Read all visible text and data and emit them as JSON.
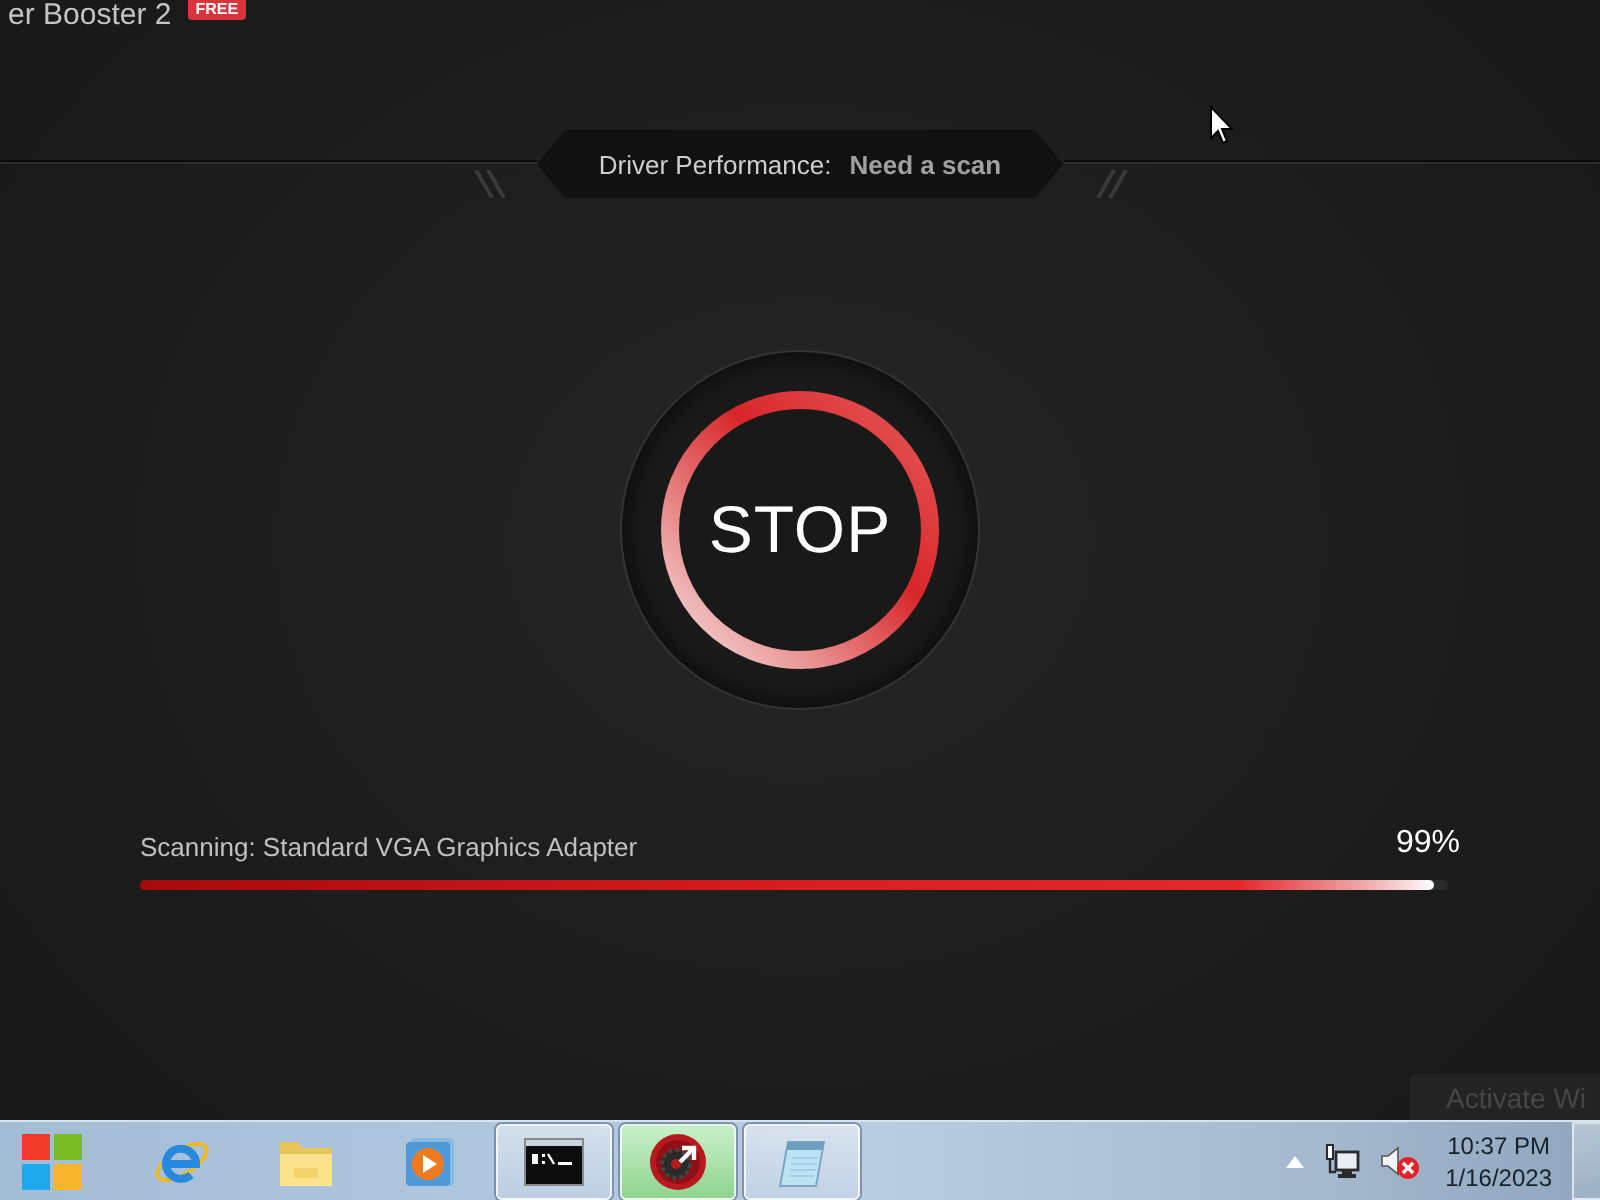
{
  "app": {
    "title": "er Booster 2",
    "badge": "FREE"
  },
  "status": {
    "label": "Driver Performance:",
    "value": "Need a scan"
  },
  "scan_button": {
    "label": "STOP"
  },
  "scan": {
    "label": "Scanning: Standard VGA Graphics Adapter",
    "percent": "99%",
    "level": 0.99
  },
  "activation_notice": "Activate Wi",
  "taskbar": {
    "items": [
      {
        "kind": "browser",
        "running": false,
        "selected": false
      },
      {
        "kind": "folder",
        "running": false,
        "selected": false
      },
      {
        "kind": "media",
        "running": false,
        "selected": false
      },
      {
        "kind": "terminal",
        "running": true,
        "selected": false
      },
      {
        "kind": "booster",
        "running": true,
        "selected": true
      },
      {
        "kind": "notepad",
        "running": true,
        "selected": false
      }
    ],
    "tray": {
      "volume_muted": true,
      "time": "10:37 PM",
      "date": "1/16/2023"
    }
  }
}
